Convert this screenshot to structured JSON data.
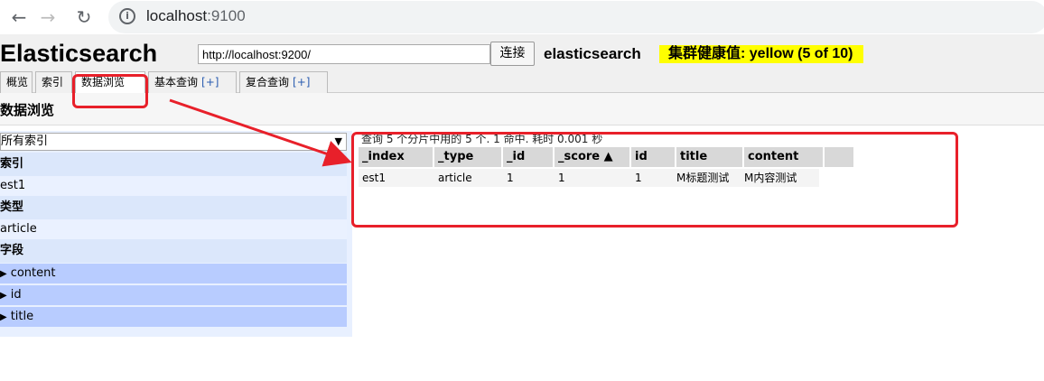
{
  "browser": {
    "url_host": "localhost",
    "url_port": ":9100",
    "back_icon": "arrow-left-icon",
    "forward_icon": "arrow-right-icon",
    "reload_icon": "reload-icon"
  },
  "header": {
    "brand": "Elasticsearch",
    "connect_url": "http://localhost:9200/",
    "connect_label": "连接",
    "cluster_name": "elasticsearch",
    "health": "集群健康值: yellow (5 of 10)",
    "health_color": "#ffff00"
  },
  "tabs": [
    {
      "label": "概览",
      "plus": ""
    },
    {
      "label": "索引",
      "plus": ""
    },
    {
      "label": "数据浏览",
      "plus": ""
    },
    {
      "label": "基本查询",
      "plus": "[+]"
    },
    {
      "label": "复合查询",
      "plus": "[+]"
    }
  ],
  "section_title": "数据浏览",
  "filters": {
    "index_select": "所有索引",
    "index_heading": "索引",
    "index_value": "est1",
    "type_heading": "类型",
    "type_value": "article",
    "field_heading": "字段",
    "fields": [
      "content",
      "id",
      "title"
    ]
  },
  "results": {
    "summary": "查询 5 个分片中用的 5 个. 1 命中. 耗时 0.001 秒",
    "columns": [
      "_index",
      "_type",
      "_id",
      "_score ▲",
      "id",
      "title",
      "content"
    ],
    "rows": [
      [
        "est1",
        "article",
        "1",
        "1",
        "1",
        "M标题测试",
        "M内容测试"
      ]
    ]
  },
  "annotation_color": "#e8202a"
}
